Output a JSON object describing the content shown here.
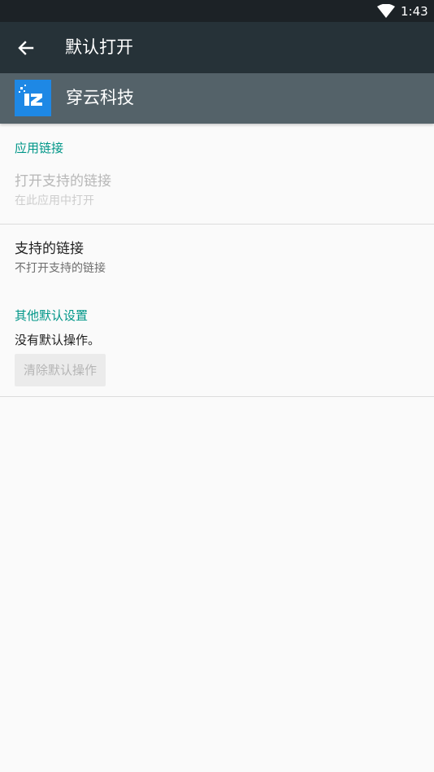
{
  "status_bar": {
    "time": "1:43",
    "wifi_icon": "wifi-icon"
  },
  "app_bar": {
    "title": "默认打开",
    "back_icon": "arrow-back-icon"
  },
  "app_header": {
    "name": "穿云科技",
    "logo_icon": "app-logo-icon"
  },
  "app_links": {
    "header": "应用链接",
    "open_supported": {
      "title": "打开支持的链接",
      "summary": "在此应用中打开",
      "enabled": false
    },
    "supported_links": {
      "title": "支持的链接",
      "summary": "不打开支持的链接"
    }
  },
  "other_defaults": {
    "header": "其他默认设置",
    "description": "没有默认操作。",
    "clear_button": "清除默认操作"
  },
  "colors": {
    "status_bar": "#1c2226",
    "app_bar": "#263238",
    "app_header": "#546269",
    "accent": "#009688",
    "logo": "#1e88e5"
  }
}
